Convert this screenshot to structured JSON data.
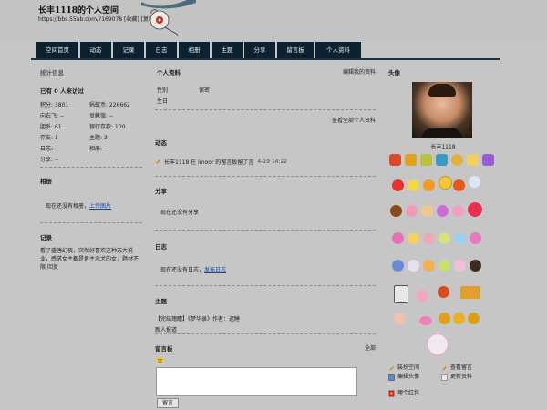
{
  "header": {
    "title": "长丰1118的个人空间",
    "url": "https://bbs.55ab.com/?169078 [收藏] [复制]"
  },
  "nav": [
    "空间首页",
    "动态",
    "记录",
    "日志",
    "相册",
    "主题",
    "分享",
    "留言板",
    "个人资料"
  ],
  "stats": {
    "heading": "统计信息",
    "visited": "已有 0 人来访过",
    "rows": [
      [
        "积分: 3801",
        "蚂蚁币: 226662"
      ],
      [
        "向右飞: --",
        "贡献值: --"
      ],
      [
        "胆系: 61",
        "银行存款: 100"
      ],
      [
        "存友: 1",
        "主题: 3"
      ],
      [
        "日志: --",
        "相册: --"
      ],
      [
        "分享: --",
        ""
      ]
    ]
  },
  "album": {
    "heading": "相册",
    "text": "现在还没有相册，",
    "link": "上传图片"
  },
  "record": {
    "heading": "记录",
    "text": "看了盛唐幻夜，突然好喜欢这种志大说业，感求女主都是男主忠犬的女，题材不限",
    "link": "回复"
  },
  "profile": {
    "heading": "个人资料",
    "edit": "编辑我的资料",
    "gender_label": "性别",
    "gender_value": "保密",
    "birthday_label": "生日",
    "view_all": "查看全部个人资料"
  },
  "feed": {
    "heading": "动态",
    "item": "长丰1118 在 lmoor 的留言板留了言",
    "time": "4-19 14:22"
  },
  "share": {
    "heading": "分享",
    "text": "现在还没有分享"
  },
  "blog": {
    "heading": "日志",
    "text": "现在还没有日志，",
    "link": "发布日志"
  },
  "topic": {
    "heading": "主题",
    "title": "【完结璁醴】《梦华录》作者：迟睡",
    "sub": "新人报道"
  },
  "board": {
    "heading": "留言板",
    "all": "全部",
    "submit": "留言"
  },
  "avatar": {
    "heading": "头像",
    "name": "长丰1118"
  },
  "actions": [
    "装扮空间",
    "查看留言",
    "编辑头像",
    "更新资料"
  ],
  "redpacket": "埋个红包"
}
